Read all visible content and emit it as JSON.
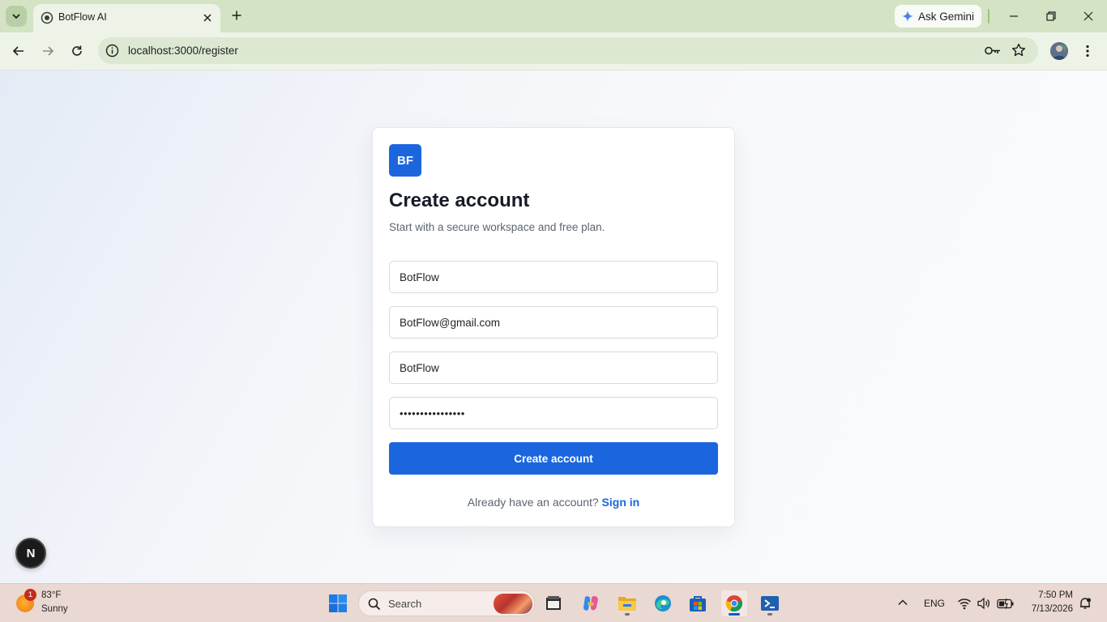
{
  "browser": {
    "tab_title": "BotFlow AI",
    "url": "localhost:3000/register",
    "gemini_label": "Ask Gemini"
  },
  "register": {
    "logo_text": "BF",
    "title": "Create account",
    "subtitle": "Start with a secure workspace and free plan.",
    "fields": {
      "name": "BotFlow",
      "email": "BotFlow@gmail.com",
      "workspace": "BotFlow",
      "password": "••••••••••••••••"
    },
    "submit_label": "Create account",
    "signin_prompt": "Already have an account?",
    "signin_link": "Sign in"
  },
  "dev_indicator": "N",
  "taskbar": {
    "weather_badge": "1",
    "weather_temp": "83°F",
    "weather_condition": "Sunny",
    "search_placeholder": "Search",
    "language": "ENG",
    "time": "7:50 PM",
    "date": "7/13/2026"
  },
  "colors": {
    "accent": "#1b66df",
    "tabstrip": "#d3e3c4",
    "taskbar": "#ead8d2"
  },
  "icons": [
    "chevron-down-icon",
    "globe-icon",
    "close-icon",
    "plus-icon",
    "gemini-sparkle-icon",
    "minimize-icon",
    "restore-icon",
    "back-arrow-icon",
    "forward-arrow-icon",
    "reload-icon",
    "site-info-icon",
    "password-key-icon",
    "bookmark-star-icon",
    "profile-avatar",
    "menu-kebab-icon",
    "windows-start-icon",
    "search-icon",
    "file-explorer-icon",
    "copilot-icon",
    "folder-icon",
    "edge-icon",
    "store-icon",
    "chrome-icon",
    "terminal-icon",
    "wifi-icon",
    "volume-icon",
    "battery-icon",
    "notification-icon"
  ]
}
